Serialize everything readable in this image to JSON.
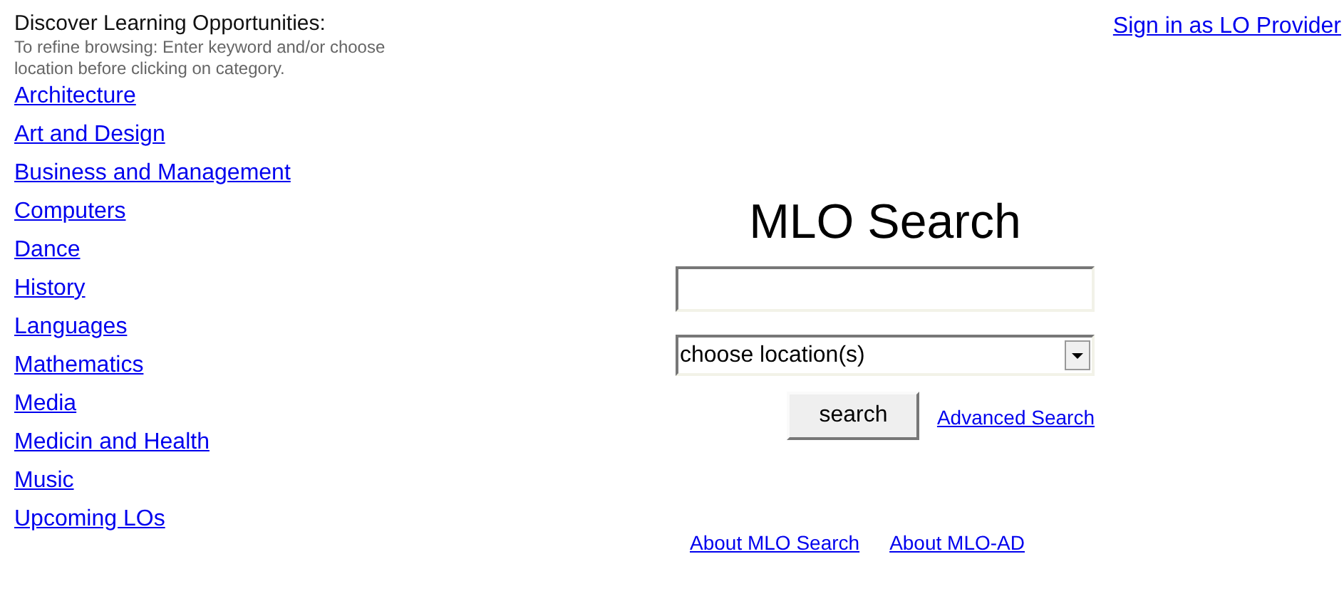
{
  "browse": {
    "heading": "Discover Learning Opportunities:",
    "hint": "To refine browsing: Enter keyword and/or choose location before clicking on category.",
    "categories": [
      "Architecture",
      "Art and Design",
      "Business and Management",
      "Computers",
      "Dance",
      "History",
      "Languages",
      "Mathematics",
      "Media",
      "Medicin and Health",
      "Music",
      "Upcoming LOs"
    ]
  },
  "sign_in_link": "Sign in as LO Provider",
  "search": {
    "title": "MLO Search",
    "location_select": "choose location(s)",
    "button": "search",
    "advanced_link": "Advanced Search"
  },
  "footer_links": [
    "About MLO Search",
    "About MLO-AD"
  ]
}
